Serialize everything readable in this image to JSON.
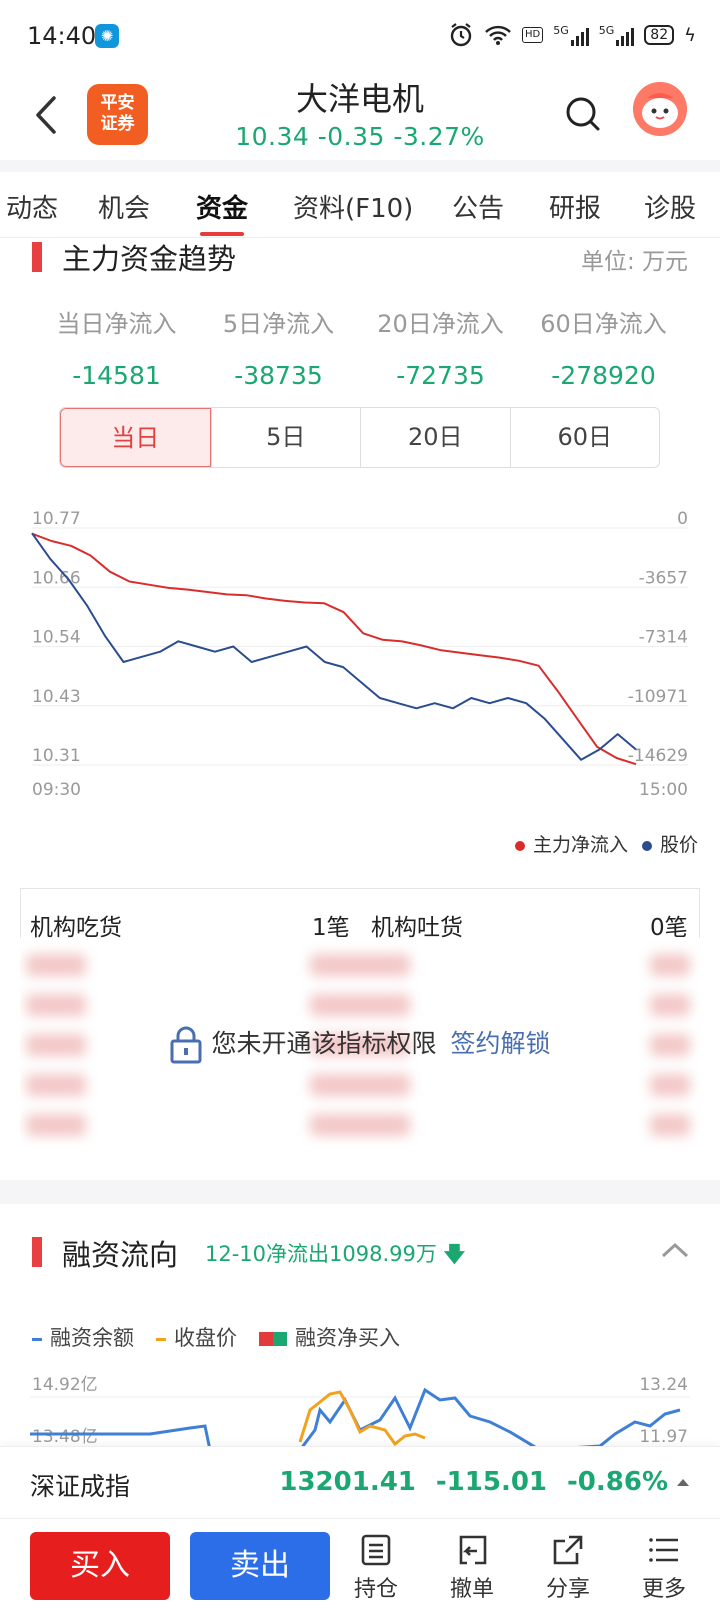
{
  "status_bar": {
    "time": "14:40",
    "battery": "82",
    "net_hd": "HD",
    "net_5g_1": "5G",
    "net_5g_2": "5G"
  },
  "header": {
    "logo_line1": "平安",
    "logo_line2": "证券",
    "stock_name": "大洋电机",
    "price": "10.34",
    "change": "-0.35",
    "change_pct": "-3.27%"
  },
  "tabs": [
    "动态",
    "机会",
    "资金",
    "资料(F10)",
    "公告",
    "研报",
    "诊股"
  ],
  "fund_trend": {
    "title": "主力资金趋势",
    "unit": "单位: 万元",
    "flows": [
      {
        "label": "当日净流入",
        "value": "-14581"
      },
      {
        "label": "5日净流入",
        "value": "-38735"
      },
      {
        "label": "20日净流入",
        "value": "-72735"
      },
      {
        "label": "60日净流入",
        "value": "-278920"
      }
    ],
    "periods": [
      "当日",
      "5日",
      "20日",
      "60日"
    ],
    "legend_flow": "主力净流入",
    "legend_price": "股价"
  },
  "chart_data": {
    "type": "line",
    "x_start": "09:30",
    "x_end": "15:00",
    "left_axis_ticks": [
      "10.77",
      "10.66",
      "10.54",
      "10.43",
      "10.31"
    ],
    "right_axis_ticks": [
      "0",
      "-3657",
      "-7314",
      "-10971",
      "-14629"
    ],
    "left_ylim": [
      10.31,
      10.77
    ],
    "right_ylim": [
      -14629,
      0
    ],
    "series": [
      {
        "name": "主力净流入",
        "color": "#d92d2d",
        "axis": "right",
        "values": [
          -350,
          -800,
          -1100,
          -1700,
          -2700,
          -3300,
          -3500,
          -3700,
          -3800,
          -3950,
          -4100,
          -4150,
          -4350,
          -4500,
          -4600,
          -4650,
          -5200,
          -6500,
          -6900,
          -7000,
          -7250,
          -7550,
          -7700,
          -7850,
          -8000,
          -8200,
          -8500,
          -10100,
          -11800,
          -13500,
          -14200,
          -14581
        ]
      },
      {
        "name": "股价",
        "color": "#2b4c8f",
        "axis": "left",
        "values": [
          10.76,
          10.71,
          10.67,
          10.62,
          10.56,
          10.51,
          10.52,
          10.53,
          10.55,
          10.54,
          10.53,
          10.54,
          10.51,
          10.52,
          10.53,
          10.54,
          10.51,
          10.5,
          10.47,
          10.44,
          10.43,
          10.42,
          10.43,
          10.42,
          10.44,
          10.43,
          10.44,
          10.43,
          10.4,
          10.36,
          10.32,
          10.34,
          10.37,
          10.34
        ]
      }
    ]
  },
  "institution": {
    "buy_label": "机构吃货",
    "buy_count": "1笔",
    "sell_label": "机构吐货",
    "sell_count": "0笔",
    "locked_text": "您未开通该指标权限",
    "unlock_link": "签约解锁"
  },
  "margin": {
    "title": "融资流向",
    "subtitle": "12-10净流出1098.99万",
    "legend": [
      "融资余额",
      "收盘价",
      "融资净买入"
    ],
    "left_ticks": [
      "14.92亿",
      "13.48亿"
    ],
    "right_ticks": [
      "13.24",
      "11.97"
    ]
  },
  "index_bar": {
    "name": "深证成指",
    "value": "13201.41",
    "change": "-115.01",
    "change_pct": "-0.86%"
  },
  "toolbar": {
    "buy": "买入",
    "sell": "卖出",
    "positions": "持仓",
    "cancel": "撤单",
    "share": "分享",
    "more": "更多"
  },
  "colors": {
    "down": "#1aa772",
    "accent": "#e84040",
    "buy": "#e61e1e",
    "sell": "#2b6ee8",
    "link": "#4a6fb0"
  }
}
